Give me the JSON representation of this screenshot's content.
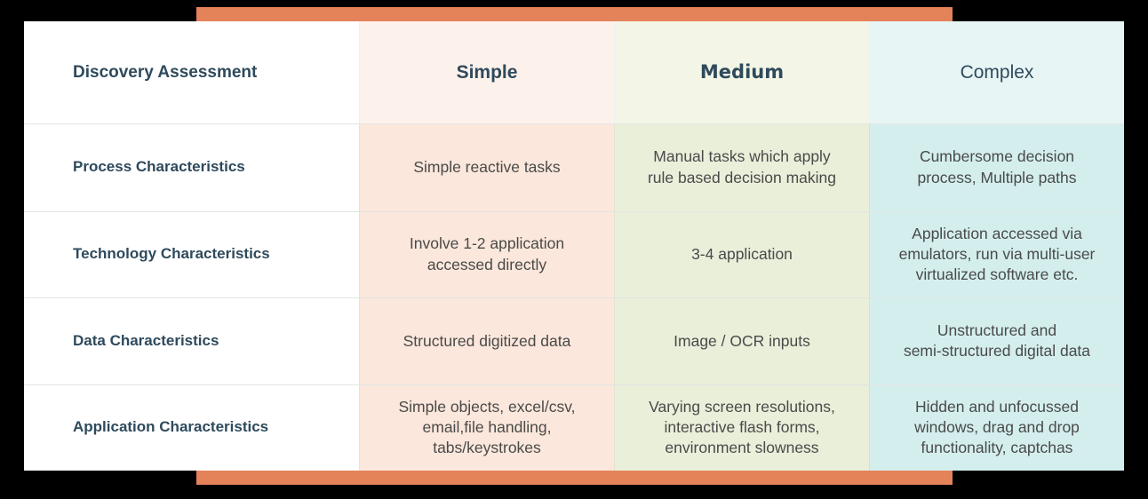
{
  "theme": {
    "accent_orange": "#e4825a",
    "header_text": "#2e4a5c",
    "body_text": "#4a4a4a",
    "simple_header_bg": "#fdf1ec",
    "simple_body_bg": "#fbe7db",
    "medium_header_bg": "#f3f6e6",
    "medium_body_bg": "#eaefda",
    "complex_header_bg": "#e8f5f5",
    "complex_body_bg": "#d4eeee",
    "canvas_bg": "#000000",
    "table_bg": "#ffffff"
  },
  "table": {
    "corner_label": "Discovery Assessment",
    "columns": [
      {
        "key": "simple",
        "label": "Simple"
      },
      {
        "key": "medium",
        "label": "Medium"
      },
      {
        "key": "complex",
        "label": "Complex"
      }
    ],
    "rows": [
      {
        "label": "Process Characteristics",
        "simple": "Simple reactive tasks",
        "medium": "Manual tasks which apply\nrule based decision making",
        "complex": "Cumbersome decision\nprocess, Multiple paths"
      },
      {
        "label": "Technology Characteristics",
        "simple": "Involve 1-2 application\naccessed directly",
        "medium": "3-4 application",
        "complex": "Application accessed via\nemulators, run via multi-user\nvirtualized software etc."
      },
      {
        "label": "Data Characteristics",
        "simple": "Structured digitized data",
        "medium": "Image / OCR inputs",
        "complex": "Unstructured and\nsemi-structured digital data"
      },
      {
        "label": "Application Characteristics",
        "simple": "Simple objects, excel/csv,\nemail,file handling,\ntabs/keystrokes",
        "medium": "Varying screen resolutions,\ninteractive flash forms,\nenvironment slowness",
        "complex": "Hidden and unfocussed\nwindows, drag and drop\nfunctionality, captchas"
      }
    ]
  }
}
